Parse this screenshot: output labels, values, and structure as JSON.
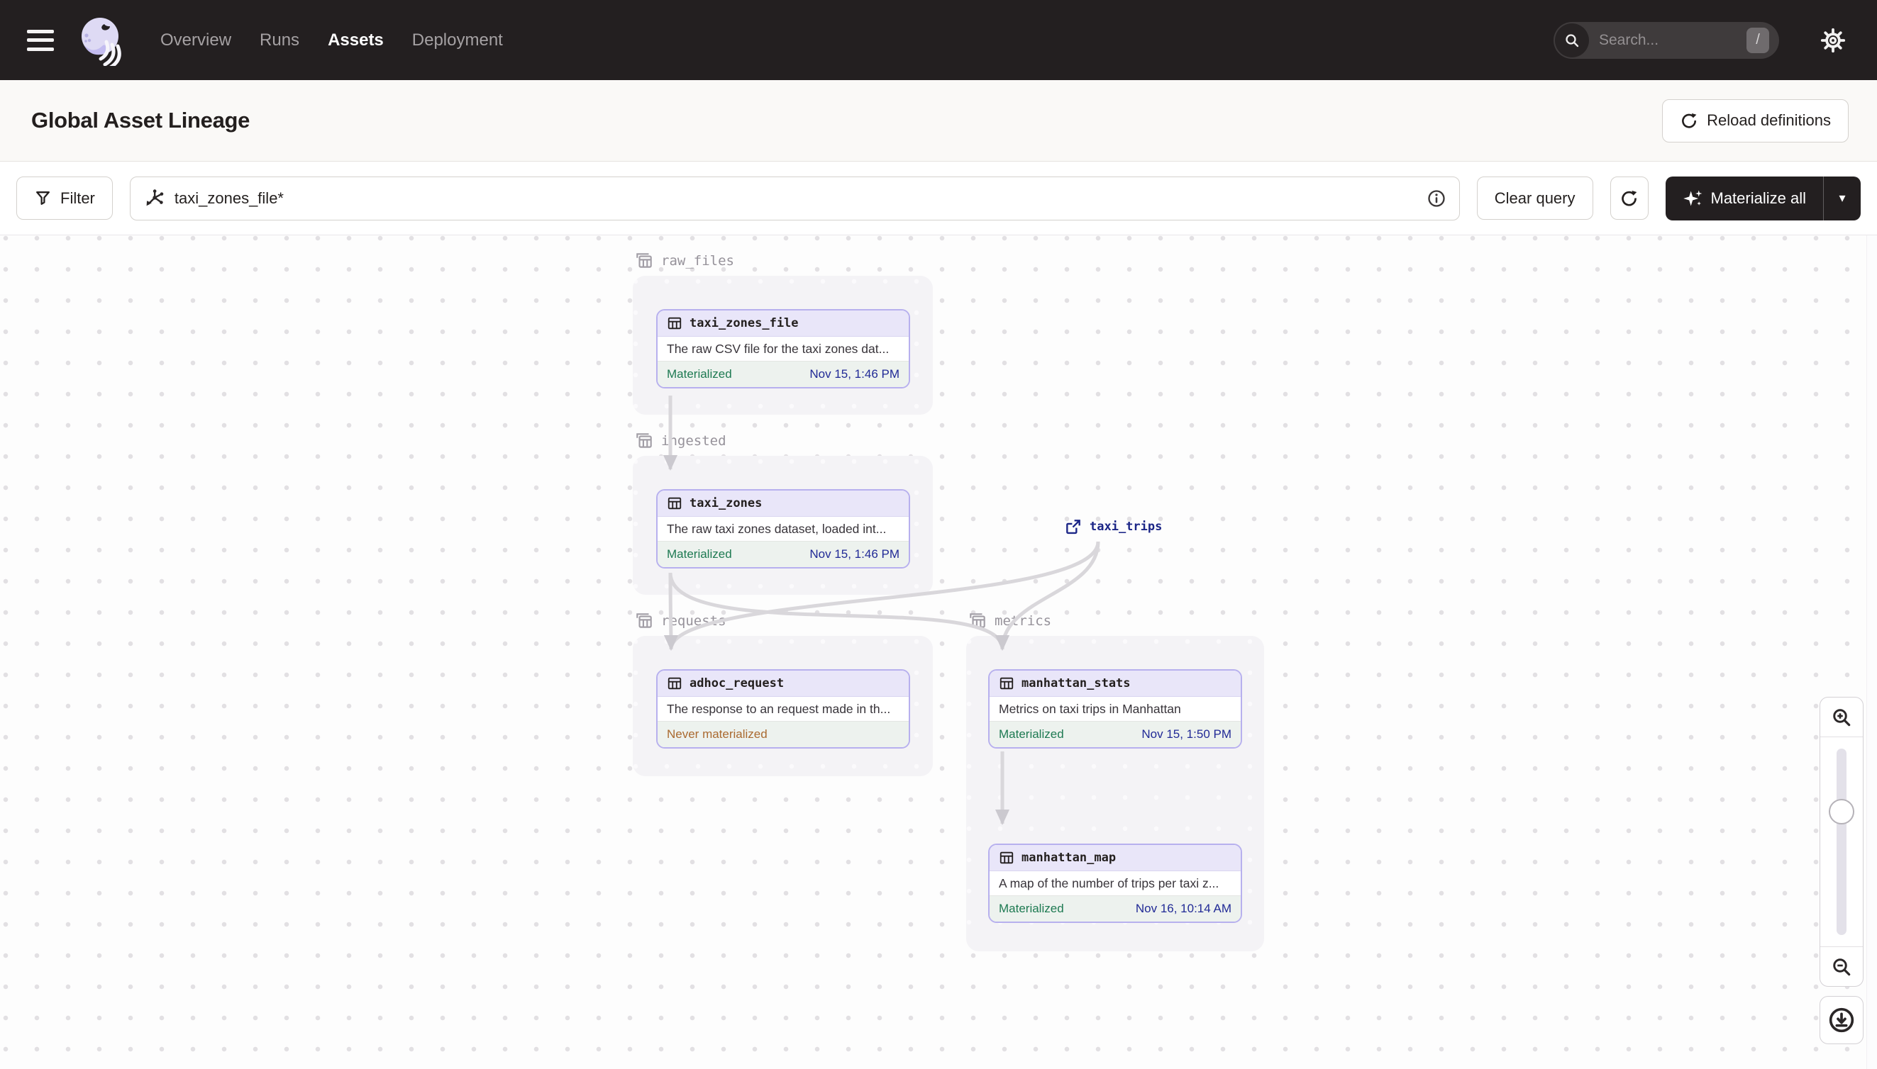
{
  "nav": {
    "links": [
      {
        "label": "Overview",
        "active": false
      },
      {
        "label": "Runs",
        "active": false
      },
      {
        "label": "Assets",
        "active": true
      },
      {
        "label": "Deployment",
        "active": false
      }
    ],
    "search": {
      "placeholder": "Search...",
      "shortcut": "/"
    }
  },
  "header": {
    "title": "Global Asset Lineage",
    "reload_button": "Reload definitions"
  },
  "toolbar": {
    "filter_label": "Filter",
    "query_value": "taxi_zones_file*",
    "clear_button": "Clear query",
    "materialize_button": "Materialize all"
  },
  "graph": {
    "groups": [
      {
        "name": "raw_files"
      },
      {
        "name": "ingested"
      },
      {
        "name": "requests"
      },
      {
        "name": "metrics"
      }
    ],
    "nodes": [
      {
        "name": "taxi_zones_file",
        "group": "raw_files",
        "description": "The raw CSV file for the taxi zones dat...",
        "status": "Materialized",
        "timestamp": "Nov 15, 1:46 PM"
      },
      {
        "name": "taxi_zones",
        "group": "ingested",
        "description": "The raw taxi zones dataset, loaded int...",
        "status": "Materialized",
        "timestamp": "Nov 15, 1:46 PM"
      },
      {
        "name": "adhoc_request",
        "group": "requests",
        "description": "The response to an request made in th...",
        "status": "Never materialized",
        "timestamp": ""
      },
      {
        "name": "manhattan_stats",
        "group": "metrics",
        "description": "Metrics on taxi trips in Manhattan",
        "status": "Materialized",
        "timestamp": "Nov 15, 1:50 PM"
      },
      {
        "name": "manhattan_map",
        "group": "metrics",
        "description": "A map of the number of trips per taxi z...",
        "status": "Materialized",
        "timestamp": "Nov 16, 10:14 AM"
      }
    ],
    "external_node": {
      "name": "taxi_trips"
    },
    "edges": [
      [
        "taxi_zones_file",
        "taxi_zones"
      ],
      [
        "taxi_zones",
        "adhoc_request"
      ],
      [
        "taxi_zones",
        "manhattan_stats"
      ],
      [
        "taxi_trips",
        "adhoc_request"
      ],
      [
        "taxi_trips",
        "manhattan_stats"
      ],
      [
        "manhattan_stats",
        "manhattan_map"
      ]
    ]
  },
  "icons": {
    "menu": "hamburger",
    "logo": "dagster-swirl",
    "search": "magnifier",
    "settings": "gear",
    "reload": "circular-arrow",
    "filter": "funnel",
    "query": "lineage-asterisk",
    "info": "circled-i",
    "materialize": "sparkles",
    "caret": "down-triangle",
    "group": "layered-table",
    "asset": "table-grid",
    "external": "external-link",
    "zoom_in": "magnifier-plus",
    "zoom_out": "magnifier-minus",
    "download": "circled-download"
  },
  "colors": {
    "nav_bg": "#231f20",
    "node_border": "#b7b0ee",
    "node_header_bg": "#e9e6f9",
    "node_footer_bg": "#edf2ee",
    "status_materialized": "#1e7a52",
    "status_never": "#aa6a30",
    "timestamp": "#212a96",
    "external_link": "#1c2687",
    "edge": "#d9d7db",
    "group_bg": "#f4f3f6"
  }
}
